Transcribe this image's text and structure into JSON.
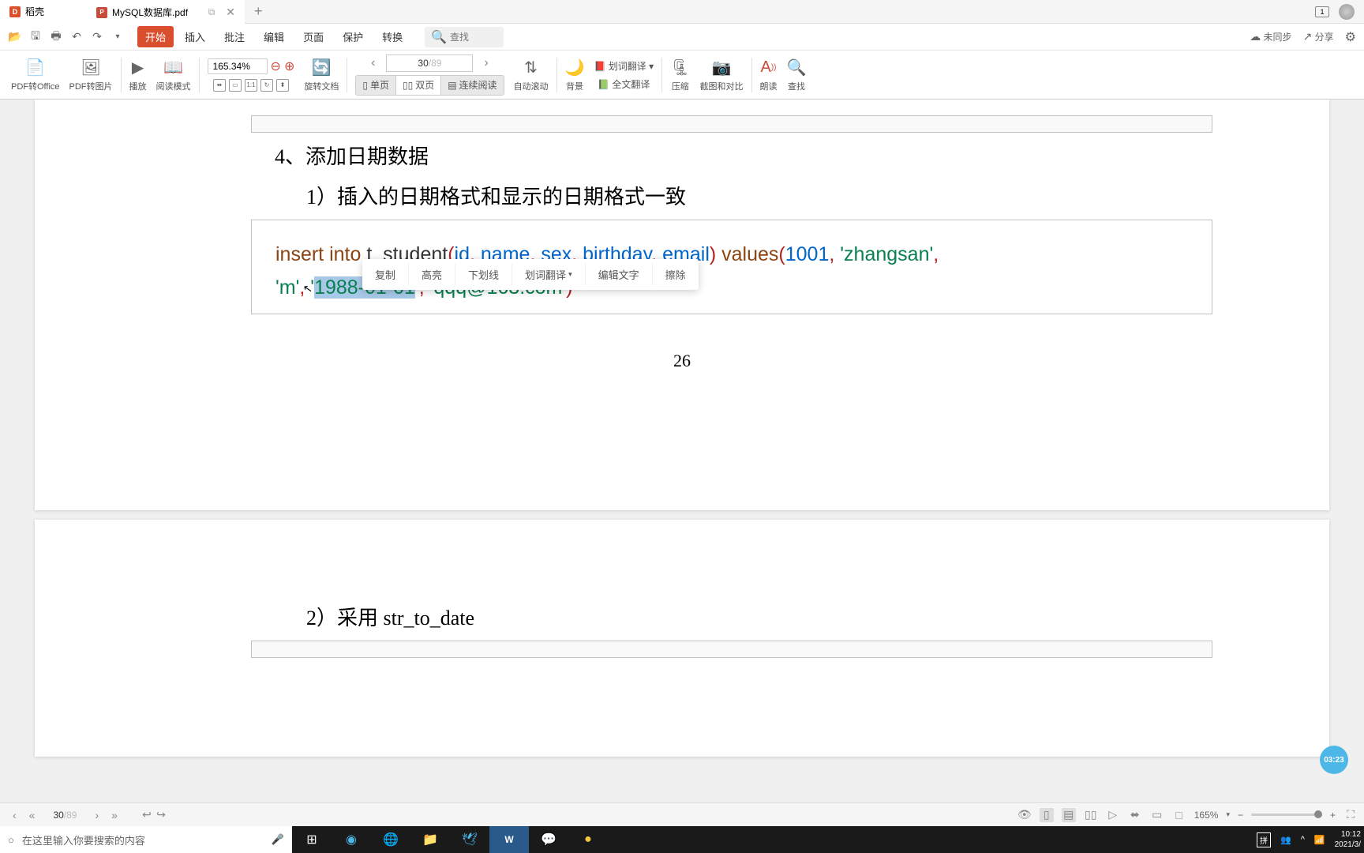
{
  "tabs": {
    "home": "稻壳",
    "active": "MySQL数据库.pdf"
  },
  "window": {
    "restore_count": "1"
  },
  "quickbar": {
    "menu": [
      "开始",
      "插入",
      "批注",
      "编辑",
      "页面",
      "保护",
      "转换"
    ],
    "search_placeholder": "查找",
    "sync": "未同步",
    "share": "分享"
  },
  "ribbon": {
    "pdf_office": "PDF转Office",
    "pdf_image": "PDF转图片",
    "play": "播放",
    "read_mode": "阅读模式",
    "zoom_value": "165.34%",
    "rotate": "旋转文档",
    "page_current": "30",
    "page_total": "/89",
    "single": "单页",
    "double": "双页",
    "continuous": "连续阅读",
    "auto_scroll": "自动滚动",
    "background": "背景",
    "word_translate": "划词翻译",
    "full_translate": "全文翻译",
    "compress": "压缩",
    "screenshot": "截图和对比",
    "read_aloud": "朗读",
    "find": "查找"
  },
  "doc": {
    "h4": "4、添加日期数据",
    "h4_1": "1）插入的日期格式和显示的日期格式一致",
    "code": {
      "p1a": "insert into",
      "p1b": " t_student",
      "p1c": "(",
      "p1d": "id",
      "p1e": ",",
      "p1f": " name",
      "p1g": ",",
      "p1h": " sex",
      "p1i": ",",
      "p1j": " birthday",
      "p1k": ",",
      "p1l": " email",
      "p1m": ")",
      "p1n": " values",
      "p1o": "(",
      "p1p": "1001",
      "p1q": ",",
      "p1r": " '",
      "p1s": "zhangsan",
      "p1t": "'",
      "p1u": ",",
      "p2a": "'",
      "p2b": "m",
      "p2c": "'",
      "p2d": ",",
      "p2e": " '",
      "p2f": "1988-01-01",
      "p2g": "'",
      "p2h": ",",
      "p2i": " '",
      "p2j": "qqq@163.com",
      "p2k": "'",
      "p2l": ")"
    },
    "pagenum": "26",
    "h4_2": "2）采用 str_to_date"
  },
  "context": [
    "复制",
    "高亮",
    "下划线",
    "划词翻译",
    "编辑文字",
    "擦除"
  ],
  "statusbar": {
    "page_cur": "30",
    "page_tot": "/89",
    "zoom": "165%"
  },
  "taskbar": {
    "search_placeholder": "在这里输入你要搜索的内容",
    "ime": "拼",
    "time": "10:12",
    "date": "2021/3/"
  },
  "timer": "03:23"
}
